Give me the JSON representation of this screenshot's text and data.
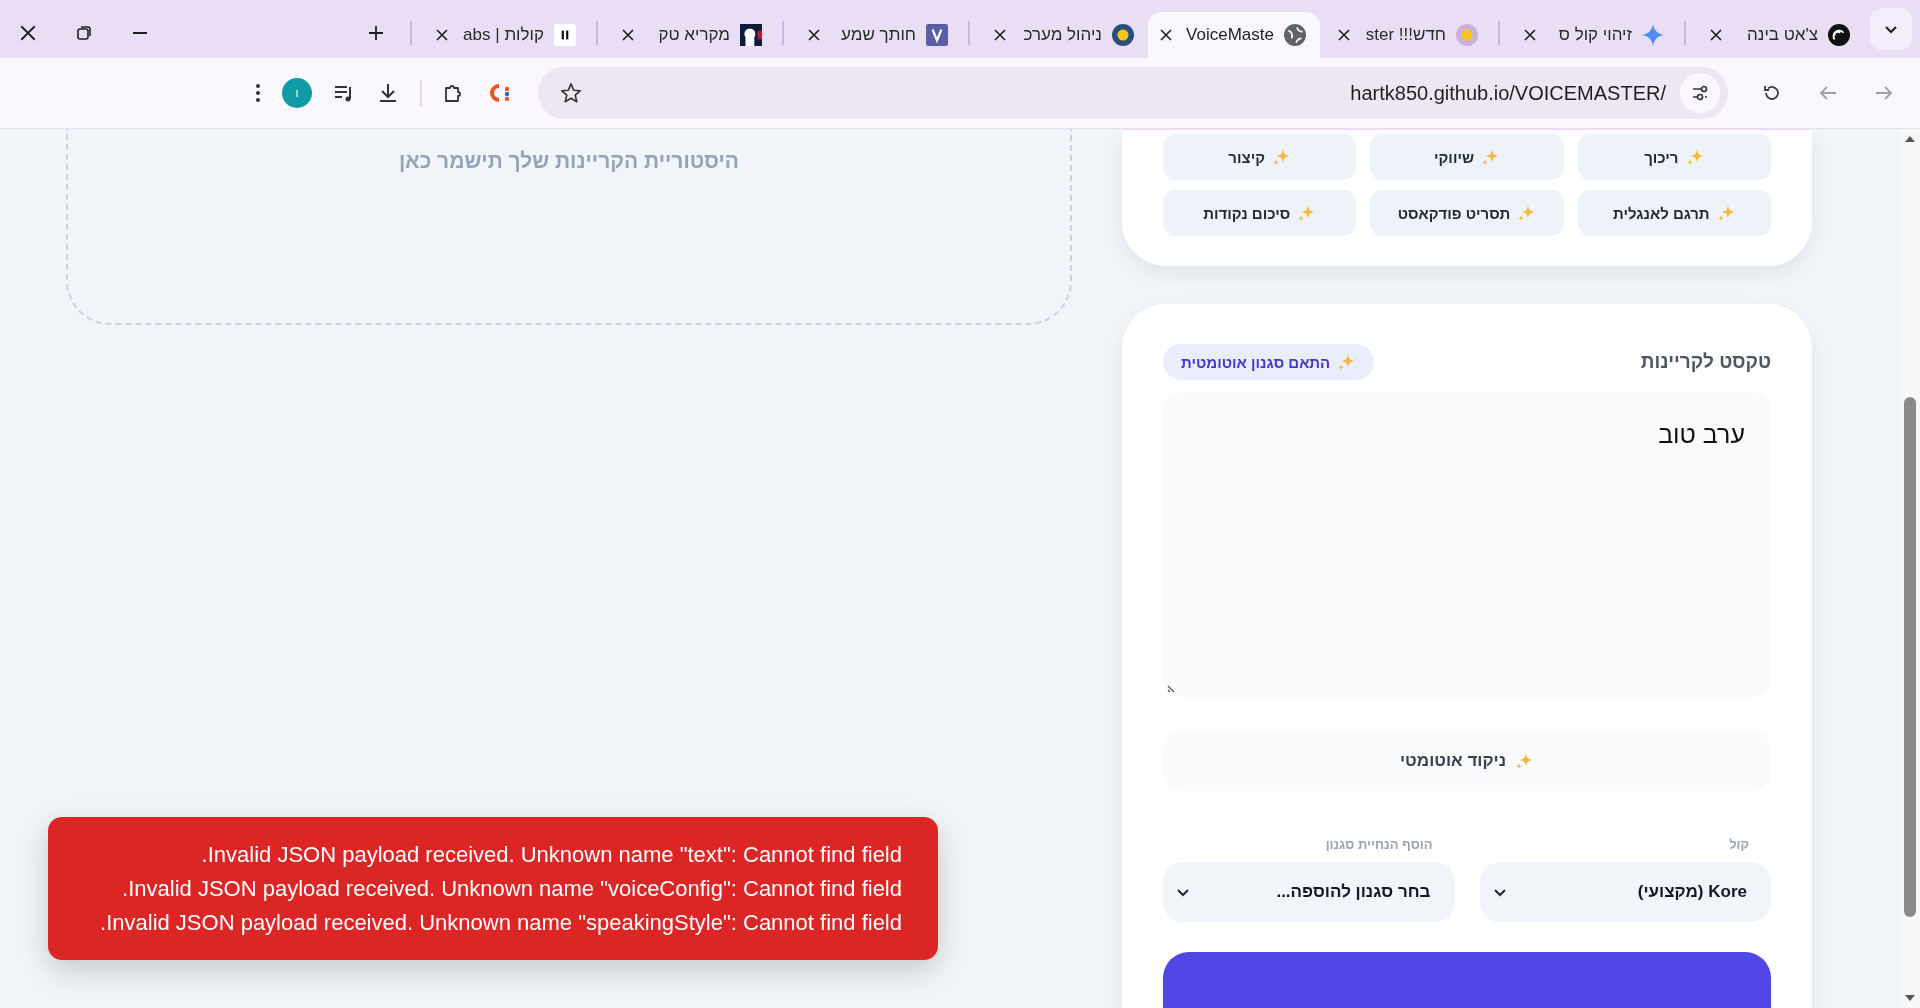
{
  "browser": {
    "tabs": [
      {
        "title": "צ'אט בינה",
        "selected": false
      },
      {
        "title": "זיהוי קול ס",
        "selected": false
      },
      {
        "title": "חדש!!! ster",
        "selected": false
      },
      {
        "title": "VoiceMaste",
        "selected": true
      },
      {
        "title": "ניהול מערכ",
        "selected": false
      },
      {
        "title": "חותך שמע",
        "selected": false
      },
      {
        "title": "מקריא טק",
        "selected": false
      },
      {
        "title": "קולות | abs",
        "selected": false
      }
    ],
    "url": "hartk850.github.io/VOICEMASTER/",
    "profile_initial": "ו"
  },
  "history": {
    "empty_message": "היסטוריית הקריינות שלך תישמר כאן"
  },
  "quick_actions": [
    "ריכוך",
    "שיווקי",
    "קיצור",
    "תרגם לאנגלית",
    "תסריט פודקאסט",
    "סיכום נקודות"
  ],
  "narration": {
    "title": "טקסט לקריינות",
    "auto_style_button": "התאם סגנון אוטומטית",
    "text": "ערב טוב",
    "nikud_button": "ניקוד אוטומטי",
    "voice": {
      "label": "קול",
      "value": "Kore (מקצועי)"
    },
    "style": {
      "label": "הוסף הנחיית סגנון",
      "value": "בחר סגנון להוספה..."
    }
  },
  "error_toast": {
    "lines": [
      "Invalid JSON payload received. Unknown name \"text\": Cannot find field.",
      "Invalid JSON payload received. Unknown name \"voiceConfig\": Cannot find field.",
      "Invalid JSON payload received. Unknown name \"speakingStyle\": Cannot find field."
    ]
  }
}
